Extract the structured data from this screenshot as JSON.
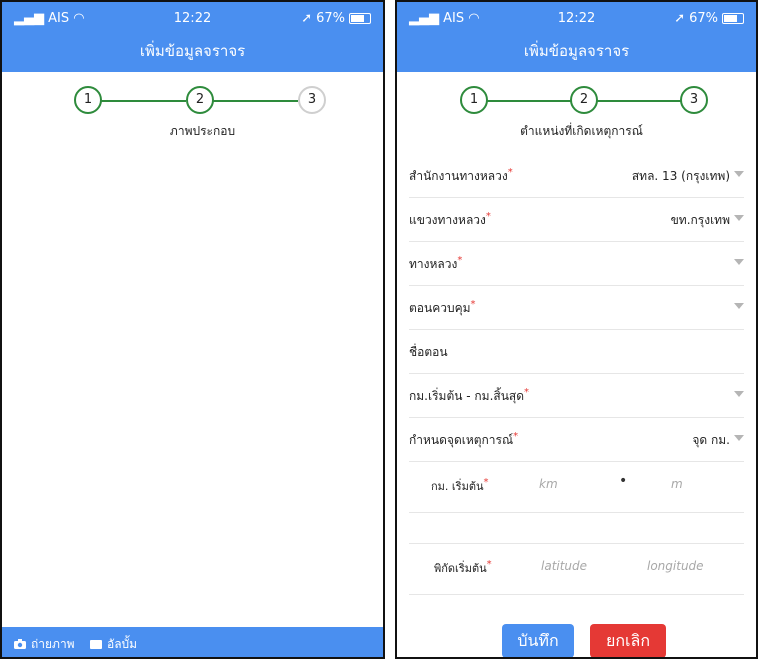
{
  "status": {
    "carrier": "AIS",
    "time": "12:22",
    "battery": "67%"
  },
  "title": "เพิ่มข้อมูลจราจร",
  "left": {
    "steps": [
      "1",
      "2",
      "3"
    ],
    "step_title": "ภาพประกอบ",
    "bottom": {
      "camera_label": "ถ่ายภาพ",
      "album_label": "อัลบั้ม"
    }
  },
  "right": {
    "steps": [
      "1",
      "2",
      "3"
    ],
    "step_title": "ตำแหน่งที่เกิดเหตุการณ์",
    "fields": {
      "office": {
        "label": "สำนักงานทางหลวง",
        "value": "สทล. 13 (กรุงเทพ)"
      },
      "district": {
        "label": "แขวงทางหลวง",
        "value": "ขท.กรุงเทพ"
      },
      "highway": {
        "label": "ทางหลวง",
        "value": ""
      },
      "control": {
        "label": "ตอนควบคุม",
        "value": ""
      },
      "section_name": {
        "label": "ชื่อตอน"
      },
      "km_range": {
        "label": "กม.เริ่มต้น - กม.สิ้นสุด",
        "value": ""
      },
      "point_type": {
        "label": "กำหนดจุดเหตุการณ์",
        "value": "จุด กม."
      },
      "km_start": {
        "label": "กม. เริ่มต้น",
        "km_placeholder": "km",
        "m_placeholder": "m"
      },
      "coords": {
        "label": "พิกัดเริ่มต้น",
        "lat_placeholder": "latitude",
        "lng_placeholder": "longitude"
      }
    },
    "buttons": {
      "save": "บันทึก",
      "cancel": "ยกเลิก"
    }
  },
  "colors": {
    "primary": "#4a8ff0",
    "step_done": "#2e8b3c",
    "required": "#e53935",
    "cancel": "#e53935"
  }
}
